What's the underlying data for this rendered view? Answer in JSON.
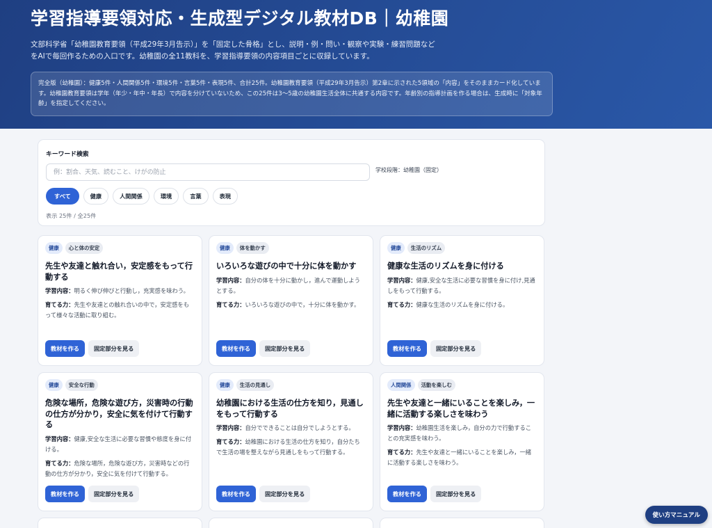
{
  "header": {
    "title": "学習指導要領対応・生成型デジタル教材DB｜幼稚園",
    "lead_line1": "文部科学省「幼稚園教育要領（平成29年3月告示）」を「固定した骨格」とし、説明・例・問い・観察や実験・練習問題など",
    "lead_line2": "をAIで毎回作るための入口です。幼稚園の全11教科を、学習指導要領の内容項目ごとに収録しています。",
    "notice": "完全版（幼稚園）：健康5件・人間関係5件・環境5件・言葉5件・表現5件、合計25件。幼稚園教育要領（平成29年3月告示）第2章に示された5領域の「内容」をそのままカード化しています。幼稚園教育要領は学年（年少・年中・年長）で内容を分けていないため、この25件は3〜5歳の幼稚園生活全体に共通する内容です。年齢別の指導計画を作る場合は、生成時に「対象年齢」を指定してください。"
  },
  "search": {
    "label": "キーワード検索",
    "placeholder": "例：割合、天気、読むこと、けがの防止",
    "stage": "学校段階：幼稚園（固定）",
    "count": "表示 25件 / 全25件"
  },
  "filters": [
    "すべて",
    "健康",
    "人間関係",
    "環境",
    "言葉",
    "表現"
  ],
  "labels": {
    "content": "学習内容：",
    "skill": "育てる力：",
    "make": "教材を作る",
    "view": "固定部分を見る"
  },
  "cards": [
    {
      "area": "健康",
      "topic": "心と体の安定",
      "title": "先生や友達と触れ合い，安定感をもって行動する",
      "content": "明るく伸び伸びと行動し，充実感を味わう。",
      "skill": "先生や友達との触れ合いの中で，安定感をもって様々な活動に取り組む。"
    },
    {
      "area": "健康",
      "topic": "体を動かす",
      "title": "いろいろな遊びの中で十分に体を動かす",
      "content": "自分の体を十分に動かし，進んで運動しようとする。",
      "skill": "いろいろな遊びの中で，十分に体を動かす。"
    },
    {
      "area": "健康",
      "topic": "生活のリズム",
      "title": "健康な生活のリズムを身に付ける",
      "content": "健康,安全な生活に必要な習慣を身に付け,見通しをもって行動する。",
      "skill": "健康な生活のリズムを身に付ける。"
    },
    {
      "area": "健康",
      "topic": "安全な行動",
      "title": "危険な場所，危険な遊び方，災害時の行動の仕方が分かり，安全に気を付けて行動する",
      "content": "健康,安全な生活に必要な習慣や態度を身に付ける。",
      "skill": "危険な場所，危険な遊び方，災害時などの行動の仕方が分かり，安全に気を付けて行動する。"
    },
    {
      "area": "健康",
      "topic": "生活の見通し",
      "title": "幼稚園における生活の仕方を知り，見通しをもって行動する",
      "content": "自分でできることは自分でしようとする。",
      "skill": "幼稚園における生活の仕方を知り，自分たちで生活の場を整えながら見通しをもって行動する。"
    },
    {
      "area": "人間関係",
      "topic": "活動を楽しむ",
      "title": "先生や友達と一緒にいることを楽しみ，一緒に活動する楽しさを味わう",
      "content": "幼稚園生活を楽しみ，自分の力で行動することの充実感を味わう。",
      "skill": "先生や友達と一緒にいることを楽しみ，一緒に活動する楽しさを味わう。"
    }
  ],
  "manual_button": "使い方マニュアル"
}
